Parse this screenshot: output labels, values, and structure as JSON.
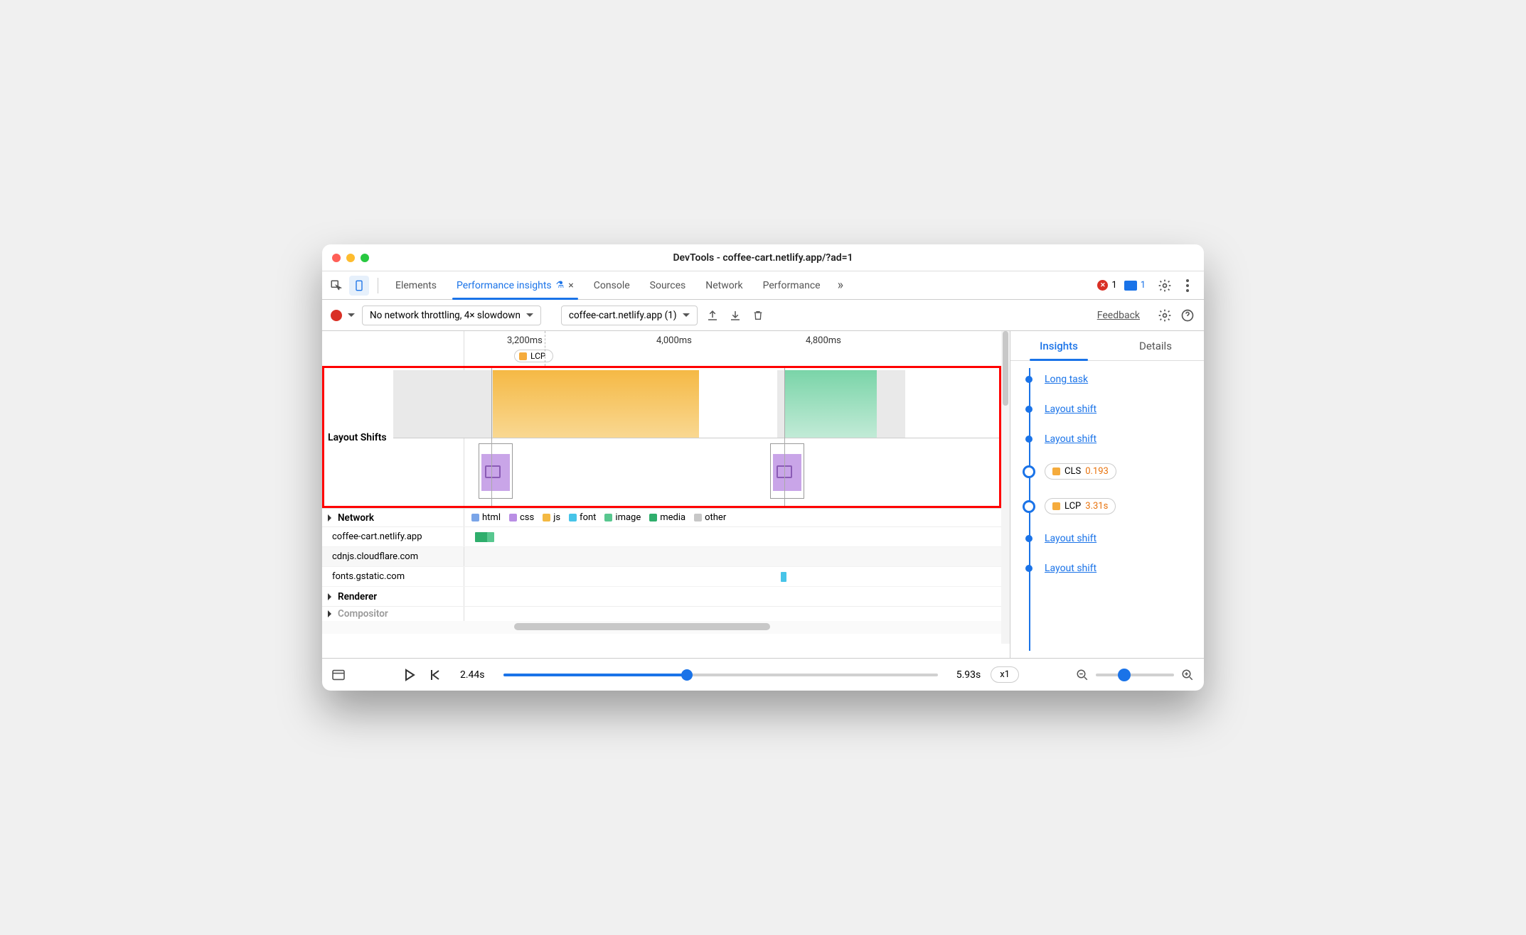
{
  "window": {
    "title": "DevTools - coffee-cart.netlify.app/?ad=1"
  },
  "tabs": {
    "elements": "Elements",
    "perf_insights": "Performance insights",
    "console": "Console",
    "sources": "Sources",
    "network": "Network",
    "performance": "Performance"
  },
  "badges": {
    "errors": "1",
    "messages": "1"
  },
  "toolbar": {
    "throttle": "No network throttling, 4× slowdown",
    "recording": "coffee-cart.netlify.app (1)",
    "feedback": "Feedback"
  },
  "ruler": {
    "t1": "3,200ms",
    "t2": "4,000ms",
    "t3": "4,800ms",
    "lcp": "LCP"
  },
  "layout_shifts_label": "Layout Shifts",
  "network_header": "Network",
  "legend": {
    "html": "html",
    "css": "css",
    "js": "js",
    "font": "font",
    "image": "image",
    "media": "media",
    "other": "other"
  },
  "net_rows": {
    "r1": "coffee-cart.netlify.app",
    "r2": "cdnjs.cloudflare.com",
    "r3": "fonts.gstatic.com"
  },
  "renderer": "Renderer",
  "compositor": "Compositor",
  "right_tabs": {
    "insights": "Insights",
    "details": "Details"
  },
  "insights": {
    "long_task": "Long task",
    "layout_shift": "Layout shift",
    "cls_label": "CLS",
    "cls_value": "0.193",
    "lcp_label": "LCP",
    "lcp_value": "3.31s"
  },
  "footer": {
    "start": "2.44s",
    "end": "5.93s",
    "speed": "x1"
  },
  "colors": {
    "html": "#7aa5e8",
    "css": "#b98ee4",
    "js": "#f4b942",
    "font": "#47c4e8",
    "image": "#58c78f",
    "media": "#2fae6c",
    "other": "#c7c7c7",
    "orange": "#f5ab3c",
    "green": "#4fcf97",
    "blue": "#1a73e8",
    "metric_orange": "#e8710a"
  }
}
